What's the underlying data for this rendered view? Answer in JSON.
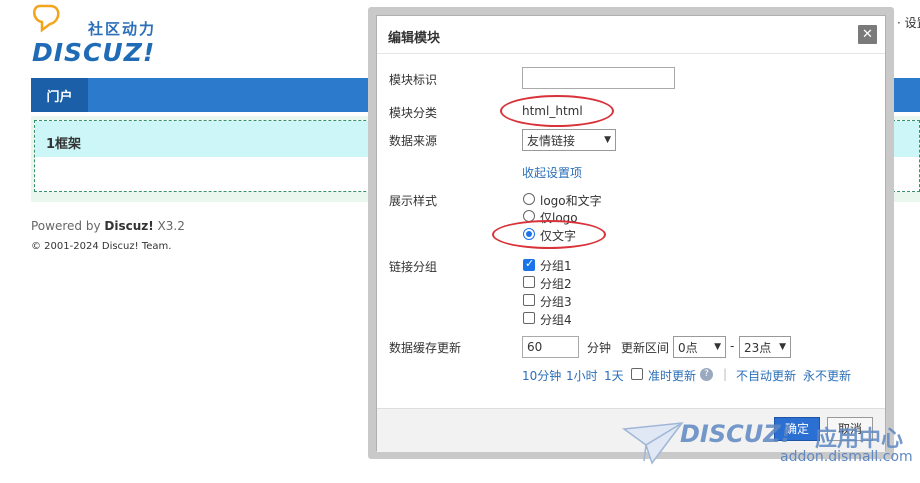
{
  "site": {
    "logo_slogan": "社区动力",
    "logo_brand": "DISCUZ!",
    "top_right_text": "· 设置"
  },
  "nav": {
    "active_tab": "门户"
  },
  "frame": {
    "title": "1框架"
  },
  "footer": {
    "powered_prefix": "Powered by ",
    "powered_brand": "Discuz!",
    "version": " X3.2",
    "copyright": "© 2001-2024 Discuz! Team."
  },
  "dialog": {
    "title": "编辑模块",
    "close_icon": "✕",
    "fields": {
      "module_id_label": "模块标识",
      "module_id_value": "",
      "category_label": "模块分类",
      "category_value": "html_html",
      "source_label": "数据来源",
      "source_value": "友情链接",
      "collapse_link": "收起设置项",
      "style_label": "展示样式",
      "style_options": [
        "logo和文字",
        "仅logo",
        "仅文字"
      ],
      "style_selected": "仅文字",
      "group_label": "链接分组",
      "group_options": [
        "分组1",
        "分组2",
        "分组3",
        "分组4"
      ],
      "group_checked": [
        "分组1"
      ],
      "cache_label": "数据缓存更新",
      "cache_value": "60",
      "cache_unit": "分钟",
      "interval_label": "更新区间",
      "interval_start": "0点",
      "interval_dash": "-",
      "interval_end": "23点",
      "quick_10min": "10分钟",
      "quick_1h": "1小时",
      "quick_1d": "1天",
      "timed_update": "准时更新",
      "sep": "|",
      "no_auto": "不自动更新",
      "never": "永不更新"
    },
    "buttons": {
      "ok": "确定",
      "cancel": "取消"
    }
  },
  "watermark": {
    "brand": "DISCUZ!",
    "cn": "应用中心",
    "url": "addon.dismall.com"
  },
  "colors": {
    "accent": "#2b6fd3",
    "nav": "#2b7acb",
    "annotation": "#d8333a"
  }
}
